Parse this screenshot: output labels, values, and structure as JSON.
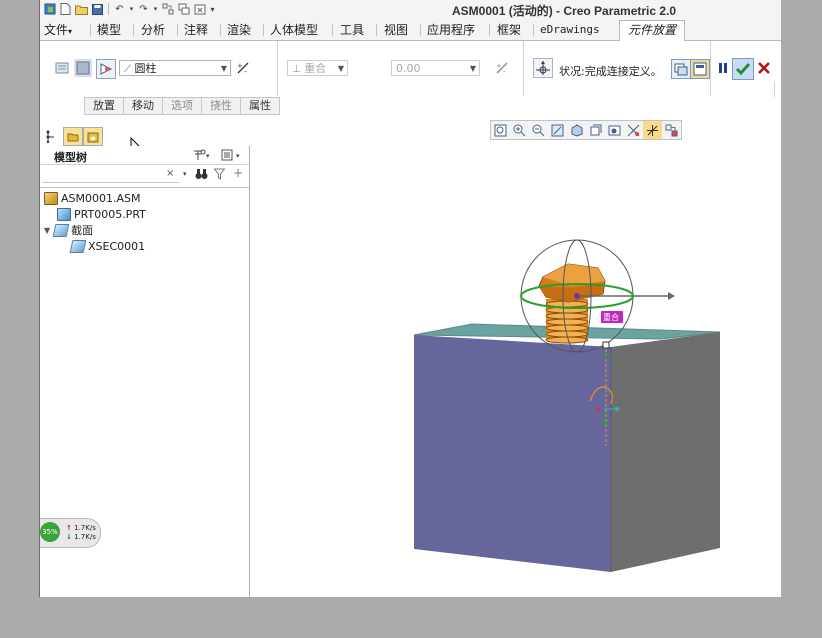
{
  "window": {
    "title": "ASM0001 (活动的) - Creo Parametric 2.0"
  },
  "ribbon_tabs": [
    {
      "label": "文件",
      "has_dropdown": true
    },
    {
      "label": "模型"
    },
    {
      "label": "分析"
    },
    {
      "label": "注释"
    },
    {
      "label": "渲染"
    },
    {
      "label": "人体模型"
    },
    {
      "label": "工具"
    },
    {
      "label": "视图"
    },
    {
      "label": "应用程序"
    },
    {
      "label": "框架"
    },
    {
      "label": "eDrawings"
    },
    {
      "label": "元件放置",
      "active": true
    }
  ],
  "placement": {
    "constraint_type": "圆柱",
    "offset_type": "重合",
    "offset_value": "0.00",
    "status": "状况:完成连接定义。"
  },
  "subtabs": [
    {
      "label": "放置",
      "enabled": true
    },
    {
      "label": "移动",
      "enabled": true
    },
    {
      "label": "选项",
      "enabled": false
    },
    {
      "label": "挠性",
      "enabled": false
    },
    {
      "label": "属性",
      "enabled": true
    }
  ],
  "model_tree": {
    "title": "模型树",
    "search_value": "",
    "items": [
      {
        "label": "ASM0001.ASM",
        "icon": "assembly-icon",
        "level": 0
      },
      {
        "label": "PRT0005.PRT",
        "icon": "part-icon",
        "level": 1
      },
      {
        "label": "截面",
        "icon": "section-folder-icon",
        "level": 1,
        "expanded": true
      },
      {
        "label": "XSEC0001",
        "icon": "section-icon",
        "level": 2
      }
    ]
  },
  "viewport": {
    "constraint_label": "重合"
  },
  "net_meter": {
    "percent": "35%",
    "upload": "1.7K/s",
    "download": "1.7K/s"
  },
  "colors": {
    "accept": "#1f8f2f",
    "cancel": "#b01818",
    "pause": "#1f3f8f",
    "block_top": "#6aa3a0",
    "block_front": "#66659c",
    "block_side": "#6e6e6e",
    "bolt": "#d9892a",
    "drag_sphere_ring": "#2aa02a"
  }
}
